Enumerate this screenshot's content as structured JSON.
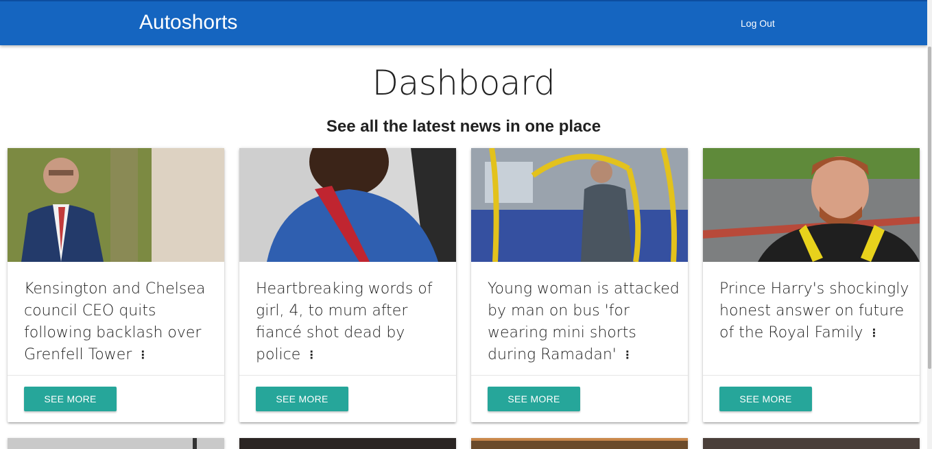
{
  "navbar": {
    "brand": "Autoshorts",
    "logout_label": "Log Out"
  },
  "header": {
    "title": "Dashboard",
    "subtitle": "See all the latest news in one place"
  },
  "cards": [
    {
      "title": "Kensington and Chelsea council CEO quits following backlash over Grenfell Tower",
      "button_label": "SEE MORE"
    },
    {
      "title": "Heartbreaking words of girl, 4, to mum after fiancé shot dead by police",
      "button_label": "SEE MORE"
    },
    {
      "title": "Young woman is attacked by man on bus 'for wearing mini shorts during Ramadan'",
      "button_label": "SEE MORE"
    },
    {
      "title": "Prince Harry's shockingly honest answer on future of the Royal Family",
      "button_label": "SEE MORE"
    }
  ],
  "icons": {
    "card_menu": "more-vert-icon"
  },
  "colors": {
    "navbar": "#1565c0",
    "button": "#26a69a"
  }
}
